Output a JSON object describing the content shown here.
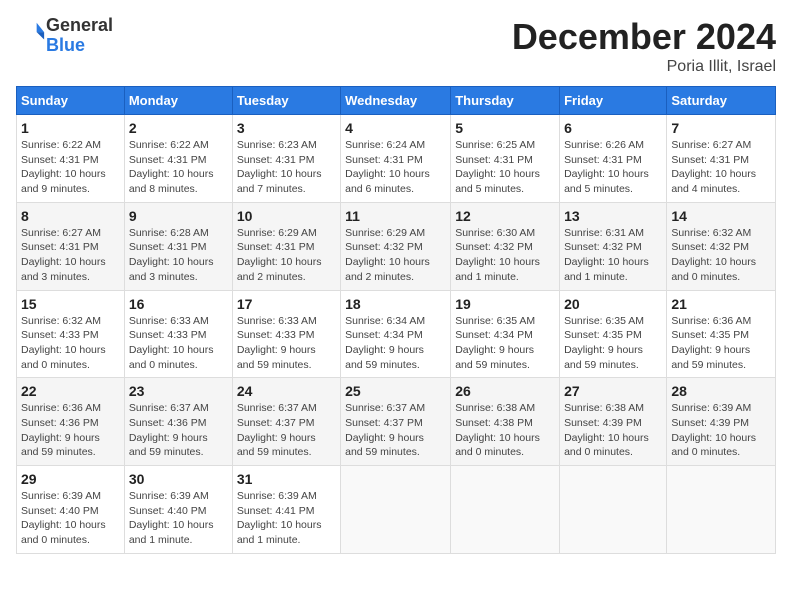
{
  "logo": {
    "line1": "General",
    "line2": "Blue"
  },
  "title": "December 2024",
  "subtitle": "Poria Illit, Israel",
  "days_of_week": [
    "Sunday",
    "Monday",
    "Tuesday",
    "Wednesday",
    "Thursday",
    "Friday",
    "Saturday"
  ],
  "weeks": [
    [
      {
        "day": 1,
        "info": "Sunrise: 6:22 AM\nSunset: 4:31 PM\nDaylight: 10 hours\nand 9 minutes."
      },
      {
        "day": 2,
        "info": "Sunrise: 6:22 AM\nSunset: 4:31 PM\nDaylight: 10 hours\nand 8 minutes."
      },
      {
        "day": 3,
        "info": "Sunrise: 6:23 AM\nSunset: 4:31 PM\nDaylight: 10 hours\nand 7 minutes."
      },
      {
        "day": 4,
        "info": "Sunrise: 6:24 AM\nSunset: 4:31 PM\nDaylight: 10 hours\nand 6 minutes."
      },
      {
        "day": 5,
        "info": "Sunrise: 6:25 AM\nSunset: 4:31 PM\nDaylight: 10 hours\nand 5 minutes."
      },
      {
        "day": 6,
        "info": "Sunrise: 6:26 AM\nSunset: 4:31 PM\nDaylight: 10 hours\nand 5 minutes."
      },
      {
        "day": 7,
        "info": "Sunrise: 6:27 AM\nSunset: 4:31 PM\nDaylight: 10 hours\nand 4 minutes."
      }
    ],
    [
      {
        "day": 8,
        "info": "Sunrise: 6:27 AM\nSunset: 4:31 PM\nDaylight: 10 hours\nand 3 minutes."
      },
      {
        "day": 9,
        "info": "Sunrise: 6:28 AM\nSunset: 4:31 PM\nDaylight: 10 hours\nand 3 minutes."
      },
      {
        "day": 10,
        "info": "Sunrise: 6:29 AM\nSunset: 4:31 PM\nDaylight: 10 hours\nand 2 minutes."
      },
      {
        "day": 11,
        "info": "Sunrise: 6:29 AM\nSunset: 4:32 PM\nDaylight: 10 hours\nand 2 minutes."
      },
      {
        "day": 12,
        "info": "Sunrise: 6:30 AM\nSunset: 4:32 PM\nDaylight: 10 hours\nand 1 minute."
      },
      {
        "day": 13,
        "info": "Sunrise: 6:31 AM\nSunset: 4:32 PM\nDaylight: 10 hours\nand 1 minute."
      },
      {
        "day": 14,
        "info": "Sunrise: 6:32 AM\nSunset: 4:32 PM\nDaylight: 10 hours\nand 0 minutes."
      }
    ],
    [
      {
        "day": 15,
        "info": "Sunrise: 6:32 AM\nSunset: 4:33 PM\nDaylight: 10 hours\nand 0 minutes."
      },
      {
        "day": 16,
        "info": "Sunrise: 6:33 AM\nSunset: 4:33 PM\nDaylight: 10 hours\nand 0 minutes."
      },
      {
        "day": 17,
        "info": "Sunrise: 6:33 AM\nSunset: 4:33 PM\nDaylight: 9 hours\nand 59 minutes."
      },
      {
        "day": 18,
        "info": "Sunrise: 6:34 AM\nSunset: 4:34 PM\nDaylight: 9 hours\nand 59 minutes."
      },
      {
        "day": 19,
        "info": "Sunrise: 6:35 AM\nSunset: 4:34 PM\nDaylight: 9 hours\nand 59 minutes."
      },
      {
        "day": 20,
        "info": "Sunrise: 6:35 AM\nSunset: 4:35 PM\nDaylight: 9 hours\nand 59 minutes."
      },
      {
        "day": 21,
        "info": "Sunrise: 6:36 AM\nSunset: 4:35 PM\nDaylight: 9 hours\nand 59 minutes."
      }
    ],
    [
      {
        "day": 22,
        "info": "Sunrise: 6:36 AM\nSunset: 4:36 PM\nDaylight: 9 hours\nand 59 minutes."
      },
      {
        "day": 23,
        "info": "Sunrise: 6:37 AM\nSunset: 4:36 PM\nDaylight: 9 hours\nand 59 minutes."
      },
      {
        "day": 24,
        "info": "Sunrise: 6:37 AM\nSunset: 4:37 PM\nDaylight: 9 hours\nand 59 minutes."
      },
      {
        "day": 25,
        "info": "Sunrise: 6:37 AM\nSunset: 4:37 PM\nDaylight: 9 hours\nand 59 minutes."
      },
      {
        "day": 26,
        "info": "Sunrise: 6:38 AM\nSunset: 4:38 PM\nDaylight: 10 hours\nand 0 minutes."
      },
      {
        "day": 27,
        "info": "Sunrise: 6:38 AM\nSunset: 4:39 PM\nDaylight: 10 hours\nand 0 minutes."
      },
      {
        "day": 28,
        "info": "Sunrise: 6:39 AM\nSunset: 4:39 PM\nDaylight: 10 hours\nand 0 minutes."
      }
    ],
    [
      {
        "day": 29,
        "info": "Sunrise: 6:39 AM\nSunset: 4:40 PM\nDaylight: 10 hours\nand 0 minutes."
      },
      {
        "day": 30,
        "info": "Sunrise: 6:39 AM\nSunset: 4:40 PM\nDaylight: 10 hours\nand 1 minute."
      },
      {
        "day": 31,
        "info": "Sunrise: 6:39 AM\nSunset: 4:41 PM\nDaylight: 10 hours\nand 1 minute."
      },
      null,
      null,
      null,
      null
    ]
  ]
}
